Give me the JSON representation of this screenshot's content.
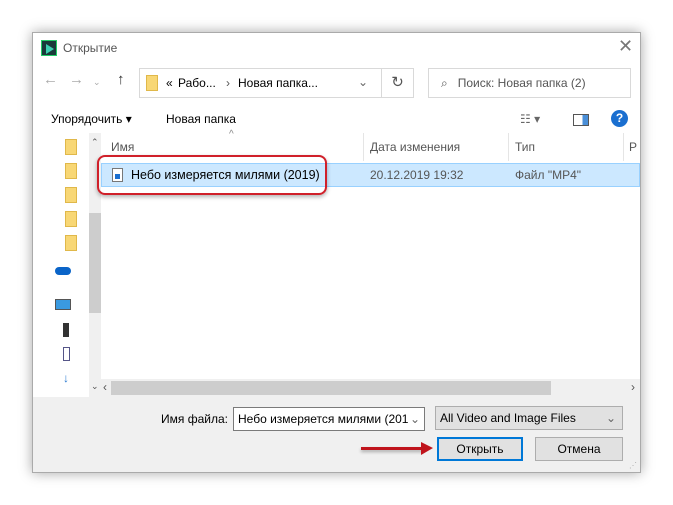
{
  "window": {
    "title": "Открытие"
  },
  "address": {
    "prefix": "«",
    "crumb1": "Рабо...",
    "sep": "›",
    "crumb2": "Новая папка..."
  },
  "search": {
    "placeholder": "Поиск: Новая папка (2)"
  },
  "toolbar": {
    "organize": "Упорядочить ▾",
    "new_folder": "Новая папка",
    "help": "?"
  },
  "columns": [
    "Имя",
    "Дата изменения",
    "Тип",
    "Р"
  ],
  "files": [
    {
      "name": "Небо измеряется милями (2019)",
      "date": "20.12.2019 19:32",
      "type": "Файл \"MP4\""
    }
  ],
  "bottom": {
    "filename_label": "Имя файла:",
    "filename_value": "Небо измеряется милями (201",
    "filter": "All Video and Image Files",
    "open": "Открыть",
    "cancel": "Отмена"
  },
  "colors": {
    "accent": "#0078d7",
    "highlight": "#d0202a",
    "selection": "#cce8ff"
  }
}
